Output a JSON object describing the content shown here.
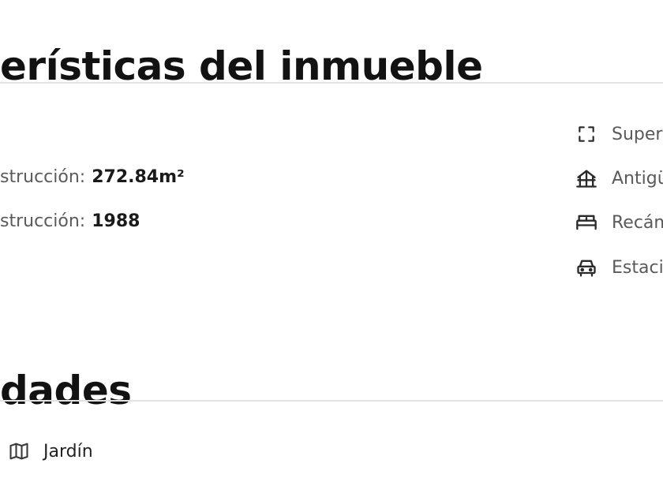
{
  "features_section": {
    "title": "erísticas del inmueble",
    "fields": [
      {
        "label": "strucción:",
        "value": "272.84m²"
      },
      {
        "label": "strucción:",
        "value": "1988"
      }
    ],
    "side_items": [
      {
        "icon": "expand-icon",
        "label": "Super"
      },
      {
        "icon": "house-structure-icon",
        "label": "Antigü"
      },
      {
        "icon": "bed-icon",
        "label": "Recám"
      },
      {
        "icon": "car-icon",
        "label": "Estaci"
      }
    ]
  },
  "amenities_section": {
    "title": "dades",
    "items": [
      {
        "icon": "garden-map-icon",
        "label": "Jardín"
      }
    ]
  }
}
